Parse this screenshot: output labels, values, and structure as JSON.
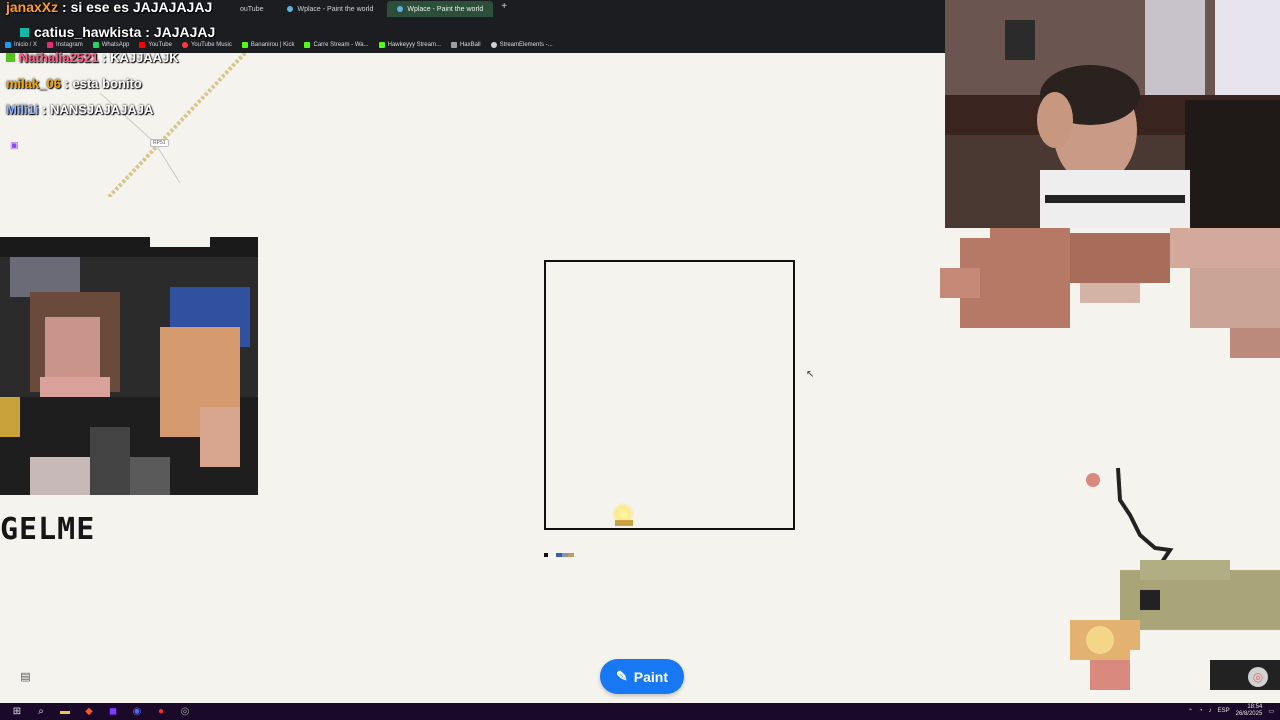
{
  "browser": {
    "tabs": [
      {
        "label": "ouTube",
        "active": false
      },
      {
        "label": "Wplace - Paint the world",
        "active": false
      },
      {
        "label": "Wplace - Paint the world",
        "active": true
      }
    ],
    "new_tab": "+",
    "bookmarks": [
      {
        "label": "Inicio / X",
        "color": "#1d9bf0"
      },
      {
        "label": "Instagram",
        "color": "#e1306c"
      },
      {
        "label": "WhatsApp",
        "color": "#25d366"
      },
      {
        "label": "YouTube",
        "color": "#ff0000"
      },
      {
        "label": "YouTube Music",
        "color": "#ff3b3b"
      },
      {
        "label": "Bananirou | Kick",
        "color": "#53fc18"
      },
      {
        "label": "Carre Stream - Wa...",
        "color": "#53fc18"
      },
      {
        "label": "Hawkeyyy Stream...",
        "color": "#53fc18"
      },
      {
        "label": "HaxBall",
        "color": "#9aa0a6"
      },
      {
        "label": "StreamElements -...",
        "color": "#cfd3d8"
      }
    ]
  },
  "chat": [
    {
      "user": "janaxXz",
      "message": "si ese es JAJAJAJAJ",
      "color": "#ff9d2b",
      "size": 14
    },
    {
      "user": "catius_hawkista",
      "message": "JAJAJAJ",
      "color": "#ffffff",
      "size": 14
    },
    {
      "user": "Nathalia2521",
      "message": "KAJJAAJK",
      "color": "#ff5f8a",
      "size": 13
    },
    {
      "user": "milak_06",
      "message": "esta bonito",
      "color": "#f2a900",
      "size": 13
    },
    {
      "user": "Mili1i",
      "message": "NANSJAJAJAJA",
      "color": "#8fb4ff",
      "size": 13
    }
  ],
  "map": {
    "road_badge": "RP51",
    "art_text": "GELME"
  },
  "actions": {
    "paint_label": "Paint",
    "paint_color": "#1877f2"
  },
  "taskbar": {
    "language": "ESP",
    "time": "18:54",
    "date": "26/8/2025"
  }
}
